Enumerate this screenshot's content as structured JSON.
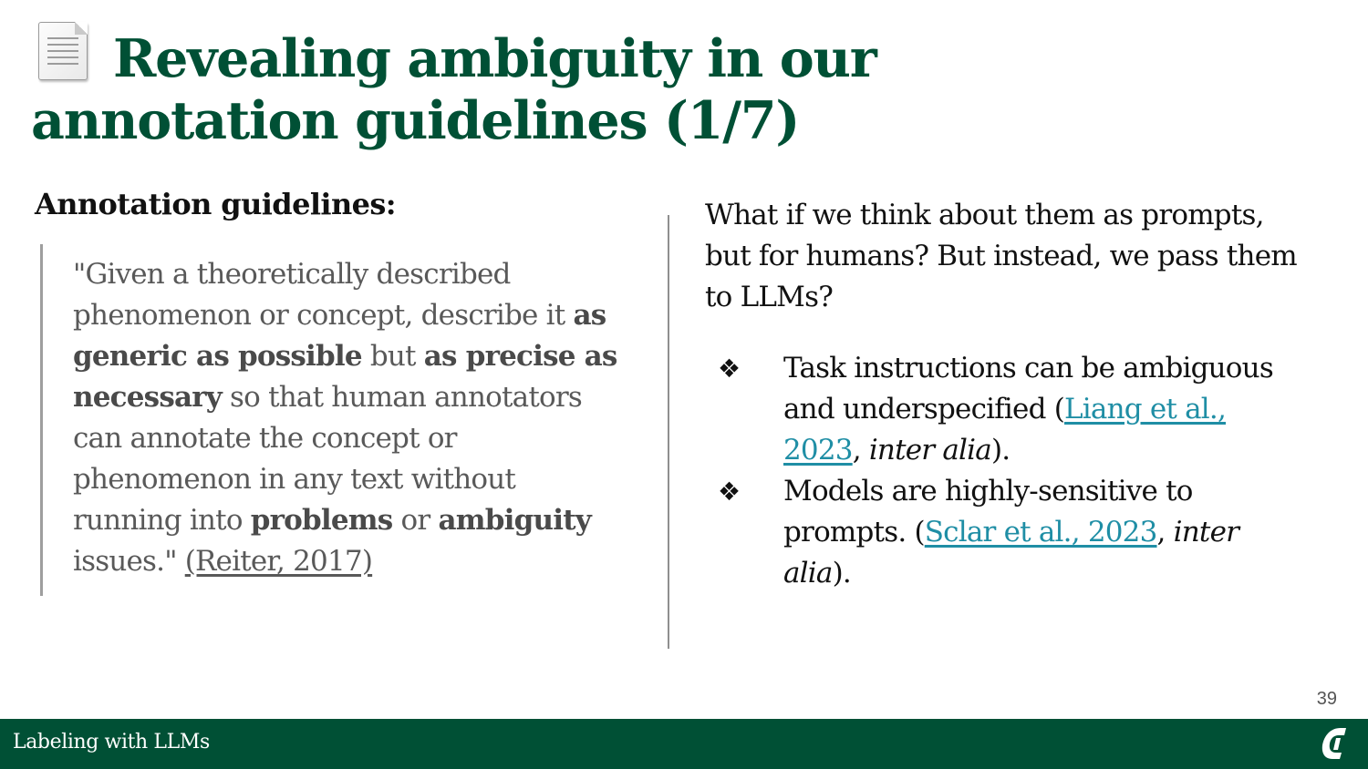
{
  "slide": {
    "title": "Revealing ambiguity in our annotation guidelines (1/7)",
    "title_icon": "page-document-icon",
    "page_number": "39"
  },
  "left": {
    "heading": "Annotation guidelines:",
    "quote": {
      "t1": "\"Given a theoretically described phenomenon or concept, describe it ",
      "b1": "as generic as possible",
      "t2": " but ",
      "b2": "as precise as necessary",
      "t3": " so that human annotators can annotate the concept or phenomenon in any text without running into ",
      "b3": "problems",
      "t4": " or ",
      "b4": "ambiguity",
      "t5": " issues.\" ",
      "citation": "(Reiter, 2017)"
    }
  },
  "right": {
    "intro": "What if we think about them as prompts, but for humans? But instead, we pass them to LLMs?",
    "bullet_icon": "four-diamond-bullet-icon",
    "bullets": [
      {
        "symbol": "❖",
        "text": "Task instructions can be ambiguous and underspecified (",
        "link": "Liang et al., 2023",
        "mid": ", ",
        "italic": "inter alia",
        "end": ")."
      },
      {
        "symbol": "❖",
        "text": "Models are highly-sensitive to prompts. (",
        "link": "Sclar et al., 2023",
        "mid": ", ",
        "italic": "inter alia",
        "end": ")."
      }
    ]
  },
  "footer": {
    "text": "Labeling with LLMs",
    "logo_icon": "university-c-logo-icon"
  },
  "colors": {
    "brand_green": "#005035",
    "link_teal": "#1f8ea5",
    "quote_gray": "#595959"
  }
}
